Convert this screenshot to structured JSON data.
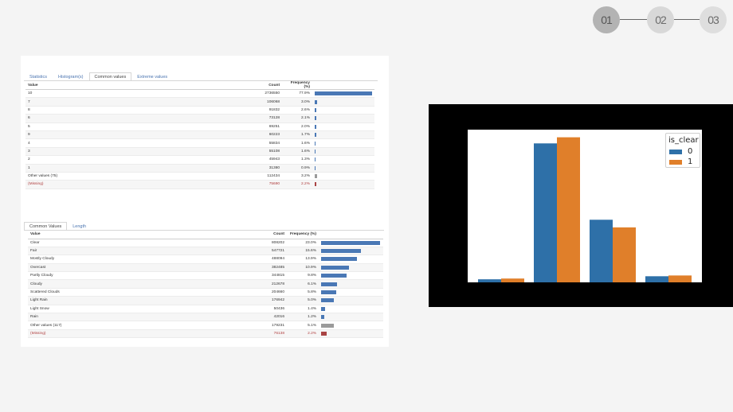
{
  "steps": [
    "01",
    "02",
    "03"
  ],
  "table1": {
    "tabs": [
      "Statistics",
      "Histogram(s)",
      "Common values",
      "Extreme values"
    ],
    "active_tab": 2,
    "headers": {
      "value": "Value",
      "count": "Count",
      "freq": "Frequency (%)"
    },
    "rows": [
      {
        "value": "10",
        "count": "2736550",
        "freq": "77.9%",
        "pct": 77.9,
        "kind": "normal"
      },
      {
        "value": "7",
        "count": "106068",
        "freq": "3.0%",
        "pct": 3.0,
        "kind": "normal"
      },
      {
        "value": "8",
        "count": "91832",
        "freq": "2.6%",
        "pct": 2.6,
        "kind": "normal"
      },
      {
        "value": "6",
        "count": "73128",
        "freq": "2.1%",
        "pct": 2.1,
        "kind": "normal"
      },
      {
        "value": "5",
        "count": "69251",
        "freq": "2.0%",
        "pct": 2.0,
        "kind": "normal"
      },
      {
        "value": "9",
        "count": "60223",
        "freq": "1.7%",
        "pct": 1.7,
        "kind": "normal"
      },
      {
        "value": "4",
        "count": "55834",
        "freq": "1.6%",
        "pct": 1.6,
        "kind": "normal"
      },
      {
        "value": "3",
        "count": "55108",
        "freq": "1.6%",
        "pct": 1.6,
        "kind": "normal"
      },
      {
        "value": "2",
        "count": "45943",
        "freq": "1.3%",
        "pct": 1.3,
        "kind": "normal"
      },
      {
        "value": "1",
        "count": "31380",
        "freq": "0.9%",
        "pct": 0.9,
        "kind": "normal"
      },
      {
        "value": "Other values (75)",
        "count": "112434",
        "freq": "3.2%",
        "pct": 3.2,
        "kind": "other"
      },
      {
        "value": "(Missing)",
        "count": "75690",
        "freq": "2.2%",
        "pct": 2.2,
        "kind": "missing"
      }
    ]
  },
  "table2": {
    "tabs": [
      "Common Values",
      "Length"
    ],
    "active_tab": 0,
    "headers": {
      "value": "Value",
      "count": "Count",
      "freq": "Frequency (%)"
    },
    "rows": [
      {
        "value": "Clear",
        "count": "808202",
        "freq": "23.0%",
        "pct": 23.0,
        "kind": "normal"
      },
      {
        "value": "Fair",
        "count": "547721",
        "freq": "15.6%",
        "pct": 15.6,
        "kind": "normal"
      },
      {
        "value": "Mostly Cloudy",
        "count": "488094",
        "freq": "13.9%",
        "pct": 13.9,
        "kind": "normal"
      },
      {
        "value": "Overcast",
        "count": "382485",
        "freq": "10.9%",
        "pct": 10.9,
        "kind": "normal"
      },
      {
        "value": "Partly Cloudy",
        "count": "344815",
        "freq": "9.8%",
        "pct": 9.8,
        "kind": "normal"
      },
      {
        "value": "Cloudy",
        "count": "212678",
        "freq": "6.1%",
        "pct": 6.1,
        "kind": "normal"
      },
      {
        "value": "Scattered Clouds",
        "count": "204660",
        "freq": "5.8%",
        "pct": 5.8,
        "kind": "normal"
      },
      {
        "value": "Light Rain",
        "count": "176942",
        "freq": "5.0%",
        "pct": 5.0,
        "kind": "normal"
      },
      {
        "value": "Light Snow",
        "count": "50436",
        "freq": "1.4%",
        "pct": 1.4,
        "kind": "normal"
      },
      {
        "value": "Rain",
        "count": "42016",
        "freq": "1.2%",
        "pct": 1.2,
        "kind": "normal"
      },
      {
        "value": "Other values (117)",
        "count": "179231",
        "freq": "5.1%",
        "pct": 5.1,
        "kind": "other"
      },
      {
        "value": "(Missing)",
        "count": "76138",
        "freq": "2.2%",
        "pct": 2.2,
        "kind": "missing"
      }
    ]
  },
  "chart_data": {
    "type": "bar",
    "categories": [
      "",
      "",
      "",
      ""
    ],
    "series": [
      {
        "name": "0",
        "color": "#2e70a8",
        "values": [
          0.02,
          0.91,
          0.41,
          0.04
        ]
      },
      {
        "name": "1",
        "color": "#e07f2a",
        "values": [
          0.025,
          0.95,
          0.36,
          0.045
        ]
      }
    ],
    "ylim": [
      0,
      1
    ],
    "legend": {
      "title": "is_clear",
      "position": "top-right"
    },
    "grid": false,
    "xlabel": "",
    "ylabel": ""
  }
}
